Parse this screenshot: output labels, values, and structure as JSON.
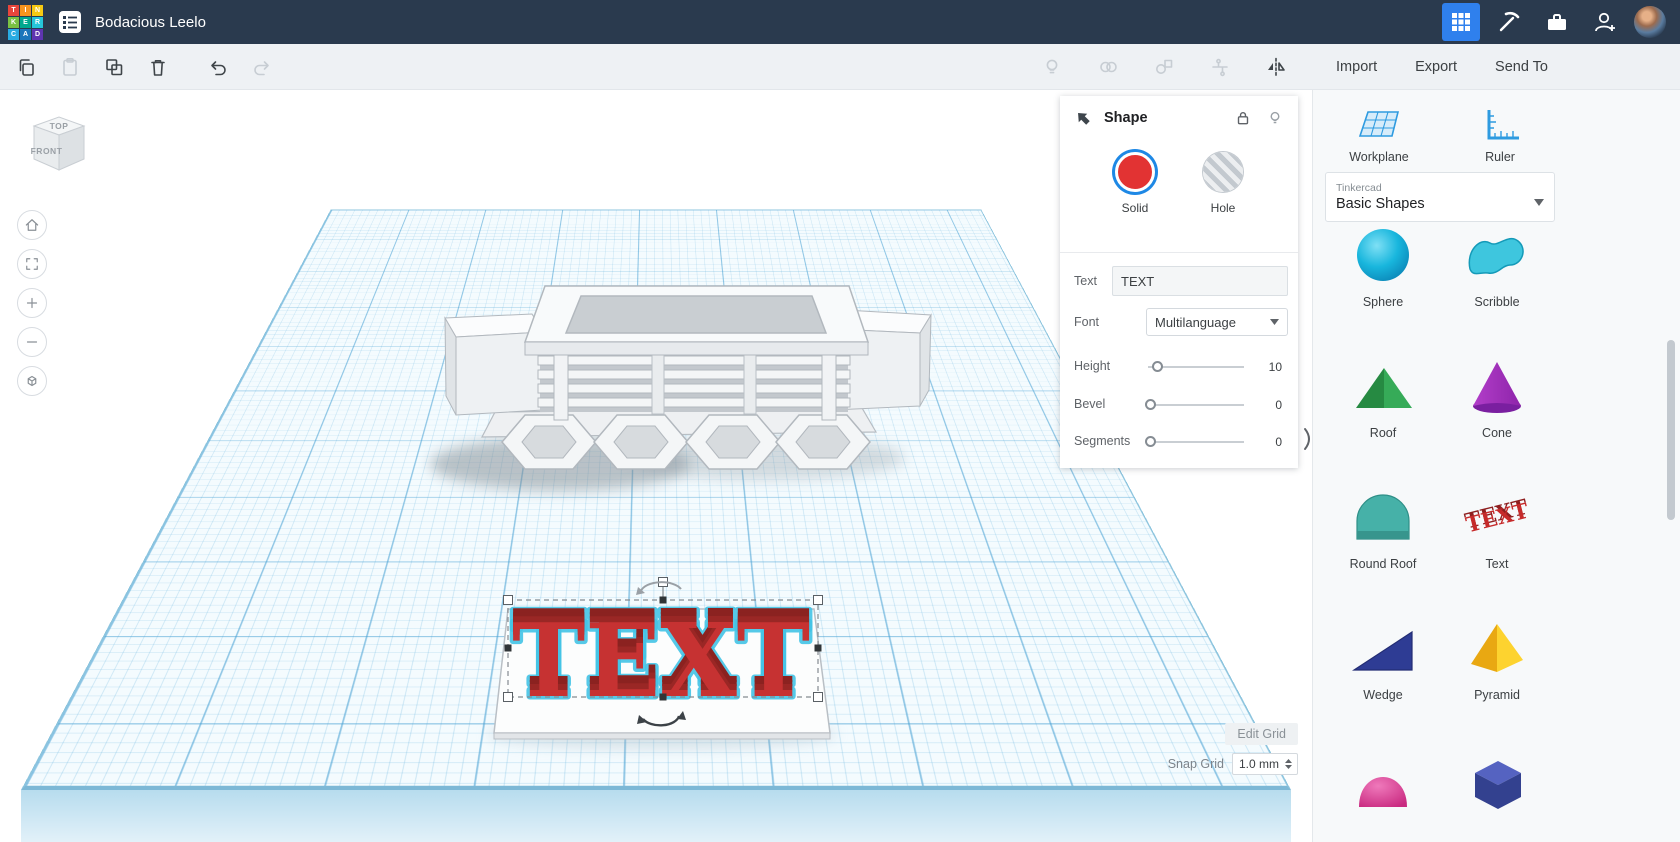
{
  "header": {
    "title": "Bodacious Leelo",
    "logo_letters": [
      "T",
      "I",
      "N",
      "K",
      "E",
      "R",
      "C",
      "A",
      "D"
    ]
  },
  "toolbar": {
    "import": "Import",
    "export": "Export",
    "send_to": "Send To"
  },
  "viewcube": {
    "top": "TOP",
    "front": "FRONT"
  },
  "inspector": {
    "title": "Shape",
    "solid": "Solid",
    "hole": "Hole",
    "text_label": "Text",
    "text_value": "TEXT",
    "font_label": "Font",
    "font_value": "Multilanguage",
    "height_label": "Height",
    "height_value": "10",
    "bevel_label": "Bevel",
    "bevel_value": "0",
    "segments_label": "Segments",
    "segments_value": "0"
  },
  "sidebar": {
    "workplane": "Workplane",
    "ruler": "Ruler",
    "brand": "Tinkercad",
    "category": "Basic Shapes",
    "shapes": [
      {
        "label": "Sphere"
      },
      {
        "label": "Scribble"
      },
      {
        "label": "Roof"
      },
      {
        "label": "Cone"
      },
      {
        "label": "Round Roof"
      },
      {
        "label": "Text",
        "icon_text": "TEXT"
      },
      {
        "label": "Wedge"
      },
      {
        "label": "Pyramid"
      }
    ]
  },
  "canvas": {
    "edit_grid": "Edit Grid",
    "snap_grid_label": "Snap Grid",
    "snap_grid_value": "1.0 mm",
    "text_object": "TEXT"
  },
  "colors": {
    "topbar_bg": "#2a3a4e",
    "accent_blue": "#2f80ed",
    "solid_red": "#e23333",
    "selection_cyan": "#44c4e6",
    "grid_blue": "#8cc4de"
  }
}
